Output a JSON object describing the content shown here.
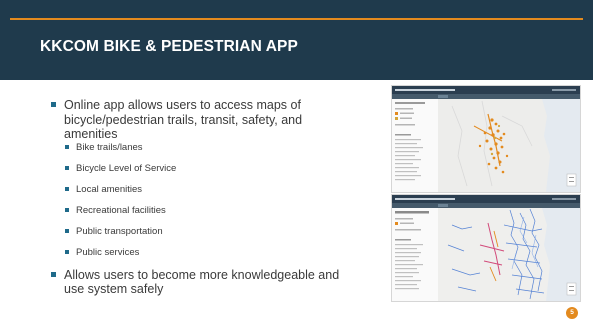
{
  "slide": {
    "title": "KKCOM BIKE & PEDESTRIAN APP",
    "page_number": "5"
  },
  "bullets": [
    "Online app allows users to access maps of bicycle/pedestrian trails, transit, safety, and amenities",
    "Allows users to become more knowledgeable and use system safely"
  ],
  "sub_bullets": [
    "Bike trails/lanes",
    "Bicycle Level of Service",
    "Local amenities",
    "Recreational facilities",
    "Public transportation",
    "Public services"
  ],
  "screenshots": [
    {
      "name": "map-screenshot-amenities",
      "accent": "#e38a1e"
    },
    {
      "name": "map-screenshot-bicycle-los",
      "accent": "#3a6fd0"
    }
  ],
  "colors": {
    "header_bg": "#1f3a4c",
    "accent": "#e38a1e",
    "bullet": "#1f6a8a",
    "text": "#3a3a3a"
  }
}
